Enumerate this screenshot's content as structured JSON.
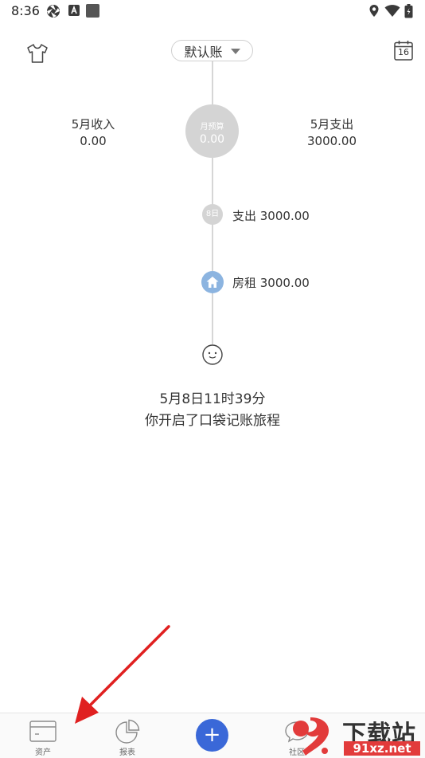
{
  "status_bar": {
    "time": "8:36",
    "left_icons": [
      "aperture-icon",
      "a-square-icon",
      "square-icon"
    ],
    "right_icons": [
      "location-icon",
      "wifi-icon",
      "battery-icon"
    ]
  },
  "header": {
    "left_icon": "tshirt-icon",
    "book_selector": {
      "selected": "默认账"
    },
    "right_icon": {
      "name": "calendar-icon",
      "day": "16"
    }
  },
  "summary": {
    "income_label": "5月收入",
    "income_value": "0.00",
    "budget_label": "月预算",
    "budget_value": "0.00",
    "expense_label": "5月支出",
    "expense_value": "3000.00"
  },
  "timeline": {
    "day_badge": "8日",
    "day_total": "支出 3000.00",
    "entries": [
      {
        "category_icon": "house-icon",
        "text": "房租 3000.00",
        "color": "#8cb4e0"
      }
    ],
    "start_icon": "smiley-icon",
    "start_time": "5月8日11时39分",
    "start_message": "你开启了口袋记账旅程"
  },
  "bottom_nav": {
    "items": [
      {
        "label": "资产",
        "icon": "wallet-card-icon"
      },
      {
        "label": "报表",
        "icon": "pie-chart-icon"
      },
      {
        "label": "",
        "icon": "plus-icon"
      },
      {
        "label": "社区",
        "icon": "chat-bubble-icon"
      }
    ],
    "accent": "#3a68d8"
  },
  "overlay": {
    "watermark_top": "下载站",
    "watermark_bottom": "91xz.net",
    "arrow_color": "#e02020"
  }
}
